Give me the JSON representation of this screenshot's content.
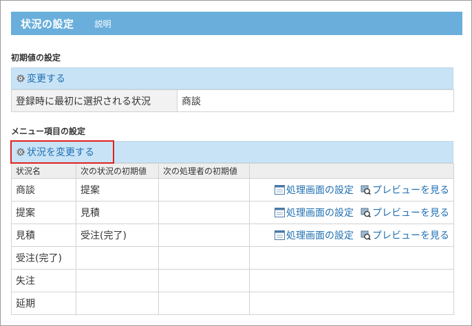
{
  "header": {
    "title": "状況の設定",
    "help_link": "説明"
  },
  "initial": {
    "section_label": "初期値の設定",
    "action": "変更する",
    "row": {
      "label": "登録時に最初に選択される状況",
      "value": "商談"
    }
  },
  "menu": {
    "section_label": "メニュー項目の設定",
    "action": "状況を変更する",
    "columns": [
      "状況名",
      "次の状況の初期値",
      "次の処理者の初期値",
      ""
    ],
    "rows": [
      {
        "name": "商談",
        "next": "提案",
        "assignee": "",
        "screen": "処理画面の設定",
        "preview": "プレビューを見る"
      },
      {
        "name": "提案",
        "next": "見積",
        "assignee": "",
        "screen": "処理画面の設定",
        "preview": "プレビューを見る"
      },
      {
        "name": "見積",
        "next": "受注(完了)",
        "assignee": "",
        "screen": "処理画面の設定",
        "preview": "プレビューを見る"
      },
      {
        "name": "受注(完了)",
        "next": "",
        "assignee": "",
        "screen": "",
        "preview": ""
      },
      {
        "name": "失注",
        "next": "",
        "assignee": "",
        "screen": "",
        "preview": ""
      },
      {
        "name": "延期",
        "next": "",
        "assignee": "",
        "screen": "",
        "preview": ""
      }
    ]
  },
  "colors": {
    "header_bg": "#6aafdb",
    "action_bar_bg": "#c9e3f6",
    "link": "#1f6fb2",
    "highlight": "#e02020"
  }
}
